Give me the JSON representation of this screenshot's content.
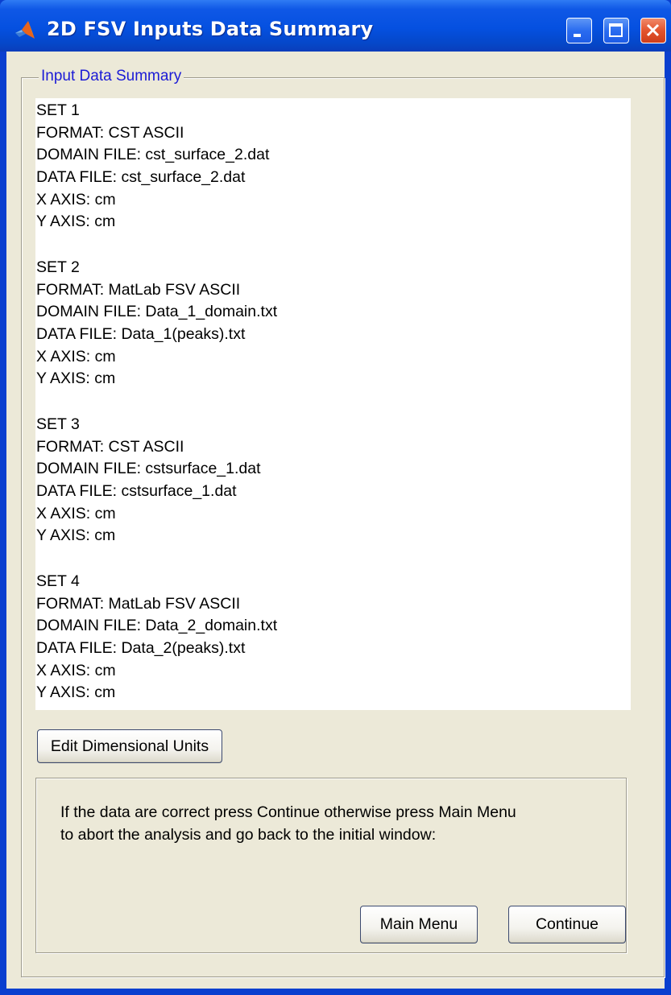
{
  "window": {
    "title": "2D FSV Inputs Data Summary"
  },
  "group": {
    "label": "Input Data Summary"
  },
  "sets": [
    {
      "header": "SET 1",
      "format": "FORMAT: CST ASCII",
      "domain_file": "DOMAIN FILE: cst_surface_2.dat",
      "data_file": "DATA FILE: cst_surface_2.dat",
      "x_axis": "X AXIS: cm",
      "y_axis": "Y AXIS: cm"
    },
    {
      "header": "SET 2",
      "format": "FORMAT: MatLab FSV ASCII",
      "domain_file": "DOMAIN FILE: Data_1_domain.txt",
      "data_file": "DATA FILE: Data_1(peaks).txt",
      "x_axis": "X AXIS: cm",
      "y_axis": "Y AXIS: cm"
    },
    {
      "header": "SET 3",
      "format": "FORMAT: CST ASCII",
      "domain_file": "DOMAIN FILE: cstsurface_1.dat",
      "data_file": "DATA FILE: cstsurface_1.dat",
      "x_axis": "X AXIS: cm",
      "y_axis": "Y AXIS: cm"
    },
    {
      "header": "SET 4",
      "format": "FORMAT: MatLab FSV ASCII",
      "domain_file": "DOMAIN FILE: Data_2_domain.txt",
      "data_file": "DATA FILE: Data_2(peaks).txt",
      "x_axis": "X AXIS: cm",
      "y_axis": "Y AXIS: cm"
    }
  ],
  "buttons": {
    "edit_units": "Edit Dimensional Units",
    "main_menu": "Main Menu",
    "continue": "Continue"
  },
  "message": {
    "line1": "If the data are correct press Continue otherwise press Main Menu",
    "line2": "to abort the analysis and go back to the initial window:"
  },
  "colors": {
    "titlebar": "#0550e0",
    "group_label": "#1b1bd6",
    "client_bg": "#ece9d8"
  }
}
